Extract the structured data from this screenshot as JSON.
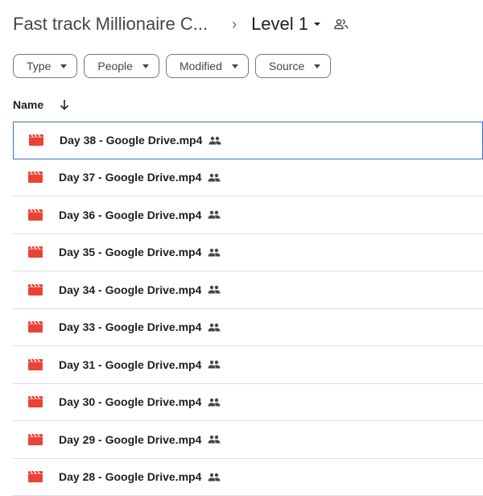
{
  "breadcrumb": {
    "parent": "Fast track Millionaire C...",
    "separator": "›",
    "current": "Level 1"
  },
  "filters": [
    {
      "label": "Type"
    },
    {
      "label": "People"
    },
    {
      "label": "Modified"
    },
    {
      "label": "Source"
    }
  ],
  "list_header": {
    "sort_column": "Name"
  },
  "files": [
    {
      "name": "Day 38 - Google Drive.mp4",
      "icon": "video-file-icon",
      "shared": true,
      "selected": true
    },
    {
      "name": "Day 37 - Google Drive.mp4",
      "icon": "video-file-icon",
      "shared": true
    },
    {
      "name": "Day 36 - Google Drive.mp4",
      "icon": "video-file-icon",
      "shared": true
    },
    {
      "name": "Day 35 - Google Drive.mp4",
      "icon": "video-file-icon",
      "shared": true
    },
    {
      "name": "Day 34 - Google Drive.mp4",
      "icon": "video-file-icon",
      "shared": true
    },
    {
      "name": "Day 33 - Google Drive.mp4",
      "icon": "video-file-icon",
      "shared": true
    },
    {
      "name": "Day 31 - Google Drive.mp4",
      "icon": "video-file-icon",
      "shared": true
    },
    {
      "name": "Day 30 - Google Drive.mp4",
      "icon": "video-file-icon",
      "shared": true
    },
    {
      "name": "Day 29 - Google Drive.mp4",
      "icon": "video-file-icon",
      "shared": true
    },
    {
      "name": "Day 28 - Google Drive.mp4",
      "icon": "video-file-icon",
      "shared": true
    }
  ],
  "colors": {
    "video_icon": "#ea4335",
    "selection_border": "#3c72c4",
    "divider": "#dadce0"
  }
}
